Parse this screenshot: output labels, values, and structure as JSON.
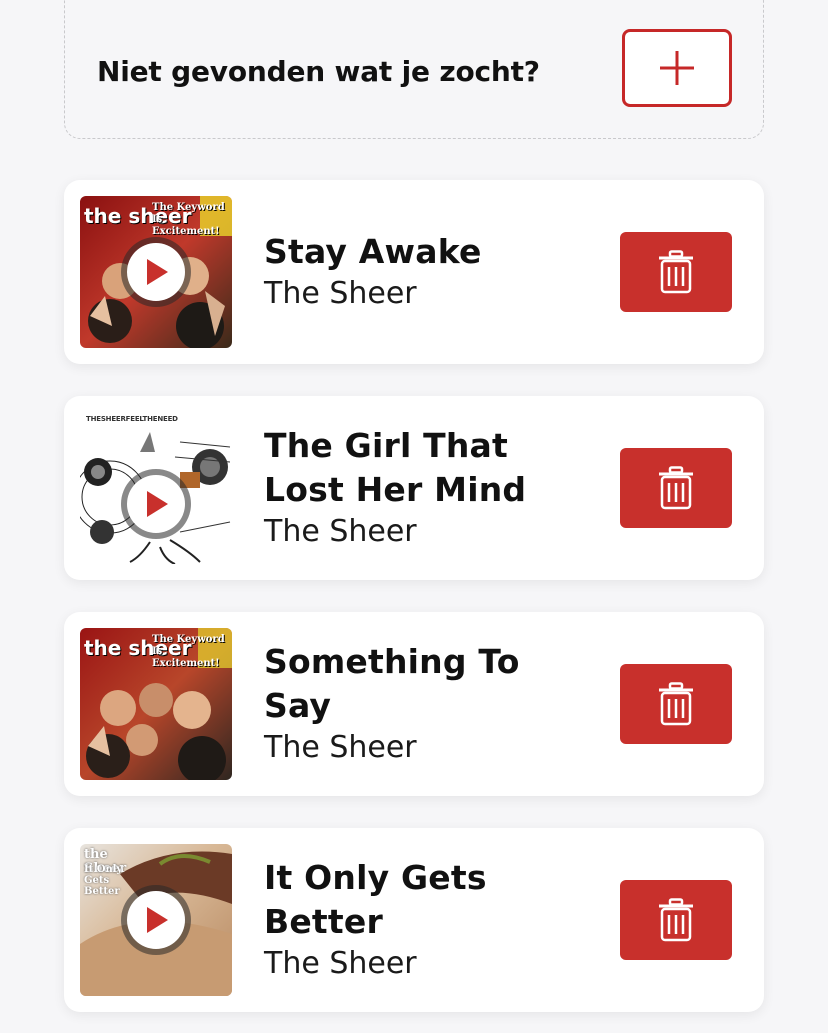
{
  "add_card": {
    "prompt": "Niet gevonden wat je zocht?",
    "add_icon": "plus-icon"
  },
  "songs": [
    {
      "title": "Stay Awake",
      "artist": "The Sheer",
      "cover_band": "the sheer",
      "cover_album": "The Keyword Is Excitement!"
    },
    {
      "title": "The Girl That Lost Her Mind",
      "artist": "The Sheer",
      "cover_album": "THESHEERFEELTHENEED"
    },
    {
      "title": "Something To Say",
      "artist": "The Sheer",
      "cover_band": "the sheer",
      "cover_album": "The Keyword Is Excitement!"
    },
    {
      "title": "It Only Gets Better",
      "artist": "The Sheer",
      "cover_band": "the Sheer",
      "cover_album": "It Only Gets Better"
    }
  ],
  "icons": {
    "play": "play-icon",
    "delete": "trash-icon"
  },
  "colors": {
    "accent": "#c8302c",
    "background": "#f6f6f8",
    "card": "#ffffff"
  }
}
